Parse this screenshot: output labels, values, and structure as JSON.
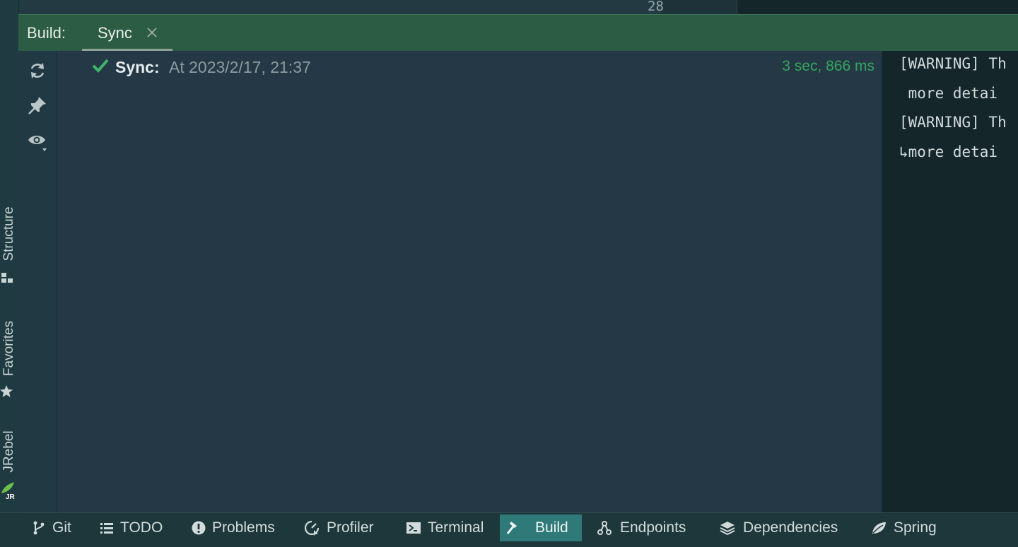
{
  "editor": {
    "gutter_line": "28"
  },
  "left_stripe": {
    "tabs": [
      {
        "label": "Structure",
        "icon": "structure-icon"
      },
      {
        "label": "Favorites",
        "icon": "star-icon"
      },
      {
        "label": "JRebel",
        "icon": "jrebel-icon"
      }
    ]
  },
  "build": {
    "title": "Build:",
    "tabs": [
      {
        "label": "Sync",
        "active": true
      }
    ]
  },
  "toolbar": {
    "buttons": [
      {
        "name": "rerun",
        "icon": "refresh-icon"
      },
      {
        "name": "pin",
        "icon": "pin-icon"
      },
      {
        "name": "view-options",
        "icon": "eye-icon"
      }
    ]
  },
  "tree": {
    "rows": [
      {
        "status": "success",
        "name": "Sync:",
        "time": "At 2023/2/17, 21:37",
        "duration": "3 sec, 866 ms"
      }
    ]
  },
  "console": {
    "lines": [
      "[WARNING] Th",
      " more detai",
      "[WARNING] Th",
      "↳more detai"
    ]
  },
  "bottom_bar": {
    "items": [
      {
        "label": "Git",
        "icon": "git-branch-icon"
      },
      {
        "label": "TODO",
        "icon": "list-icon"
      },
      {
        "label": "Problems",
        "icon": "problems-icon"
      },
      {
        "label": "Profiler",
        "icon": "profiler-icon"
      },
      {
        "label": "Terminal",
        "icon": "terminal-icon"
      },
      {
        "label": "Build",
        "icon": "hammer-icon",
        "active": true
      },
      {
        "label": "Endpoints",
        "icon": "endpoints-icon"
      },
      {
        "label": "Dependencies",
        "icon": "layers-icon"
      },
      {
        "label": "Spring",
        "icon": "spring-leaf-icon"
      }
    ]
  },
  "colors": {
    "header_bg": "#2d5c44",
    "panel_bg": "#243945",
    "active_tab": "#2f7a78",
    "success": "#35a65e"
  }
}
